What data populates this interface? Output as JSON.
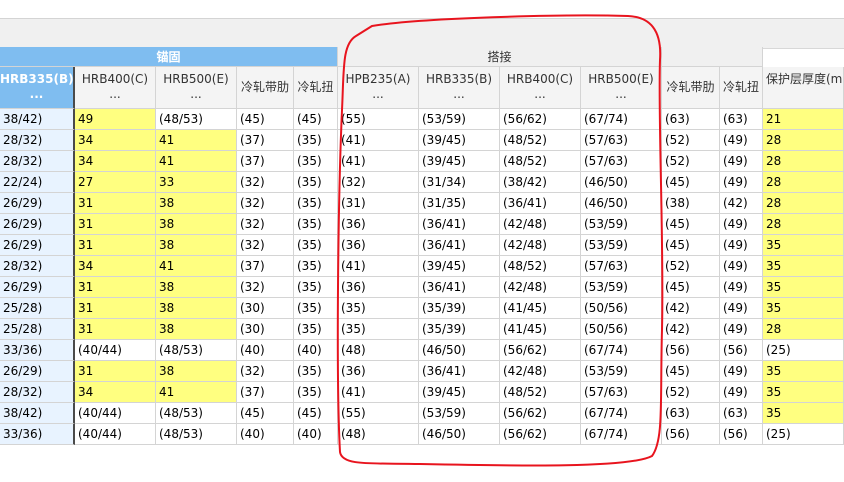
{
  "groups": {
    "anchorage": "锚固",
    "lap": "搭接"
  },
  "headers": [
    [
      "HRB335(B)",
      "..."
    ],
    [
      "HRB400(C)",
      "..."
    ],
    [
      "HRB500(E)",
      "..."
    ],
    [
      "冷轧带肋",
      ""
    ],
    [
      "冷轧扭",
      ""
    ],
    [
      "HPB235(A)",
      "..."
    ],
    [
      "HRB335(B)",
      "..."
    ],
    [
      "HRB400(C)",
      "..."
    ],
    [
      "HRB500(E)",
      "..."
    ],
    [
      "冷轧带肋",
      ""
    ],
    [
      "冷轧扭",
      ""
    ],
    [
      "保护层厚度(mm",
      ""
    ]
  ],
  "rows": [
    [
      "38/42)",
      "49",
      "(48/53)",
      "(45)",
      "(45)",
      "(55)",
      "(53/59)",
      "(56/62)",
      "(67/74)",
      "(63)",
      "(63)",
      "21"
    ],
    [
      "28/32)",
      "34",
      "41",
      "(37)",
      "(35)",
      "(41)",
      "(39/45)",
      "(48/52)",
      "(57/63)",
      "(52)",
      "(49)",
      "28"
    ],
    [
      "28/32)",
      "34",
      "41",
      "(37)",
      "(35)",
      "(41)",
      "(39/45)",
      "(48/52)",
      "(57/63)",
      "(52)",
      "(49)",
      "28"
    ],
    [
      "22/24)",
      "27",
      "33",
      "(32)",
      "(35)",
      "(32)",
      "(31/34)",
      "(38/42)",
      "(46/50)",
      "(45)",
      "(49)",
      "28"
    ],
    [
      "26/29)",
      "31",
      "38",
      "(32)",
      "(35)",
      "(31)",
      "(31/35)",
      "(36/41)",
      "(46/50)",
      "(38)",
      "(42)",
      "28"
    ],
    [
      "26/29)",
      "31",
      "38",
      "(32)",
      "(35)",
      "(36)",
      "(36/41)",
      "(42/48)",
      "(53/59)",
      "(45)",
      "(49)",
      "28"
    ],
    [
      "26/29)",
      "31",
      "38",
      "(32)",
      "(35)",
      "(36)",
      "(36/41)",
      "(42/48)",
      "(53/59)",
      "(45)",
      "(49)",
      "35"
    ],
    [
      "28/32)",
      "34",
      "41",
      "(37)",
      "(35)",
      "(41)",
      "(39/45)",
      "(48/52)",
      "(57/63)",
      "(52)",
      "(49)",
      "35"
    ],
    [
      "26/29)",
      "31",
      "38",
      "(32)",
      "(35)",
      "(36)",
      "(36/41)",
      "(42/48)",
      "(53/59)",
      "(45)",
      "(49)",
      "35"
    ],
    [
      "25/28)",
      "31",
      "38",
      "(30)",
      "(35)",
      "(35)",
      "(35/39)",
      "(41/45)",
      "(50/56)",
      "(42)",
      "(49)",
      "35"
    ],
    [
      "25/28)",
      "31",
      "38",
      "(30)",
      "(35)",
      "(35)",
      "(35/39)",
      "(41/45)",
      "(50/56)",
      "(42)",
      "(49)",
      "28"
    ],
    [
      "33/36)",
      "(40/44)",
      "(48/53)",
      "(40)",
      "(40)",
      "(48)",
      "(46/50)",
      "(56/62)",
      "(67/74)",
      "(56)",
      "(56)",
      "(25)"
    ],
    [
      "26/29)",
      "31",
      "38",
      "(32)",
      "(35)",
      "(36)",
      "(36/41)",
      "(42/48)",
      "(53/59)",
      "(45)",
      "(49)",
      "35"
    ],
    [
      "28/32)",
      "34",
      "41",
      "(37)",
      "(35)",
      "(41)",
      "(39/45)",
      "(48/52)",
      "(57/63)",
      "(52)",
      "(49)",
      "35"
    ],
    [
      "38/42)",
      "(40/44)",
      "(48/53)",
      "(45)",
      "(45)",
      "(55)",
      "(53/59)",
      "(56/62)",
      "(67/74)",
      "(63)",
      "(63)",
      "35"
    ],
    [
      "33/36)",
      "(40/44)",
      "(48/53)",
      "(40)",
      "(40)",
      "(48)",
      "(46/50)",
      "(56/62)",
      "(67/74)",
      "(56)",
      "(56)",
      "(25)"
    ]
  ],
  "colors": {
    "highlight_yellow": "#ffff80",
    "selected_header": "#7fbdf0",
    "annotation_red": "#e8141e"
  }
}
